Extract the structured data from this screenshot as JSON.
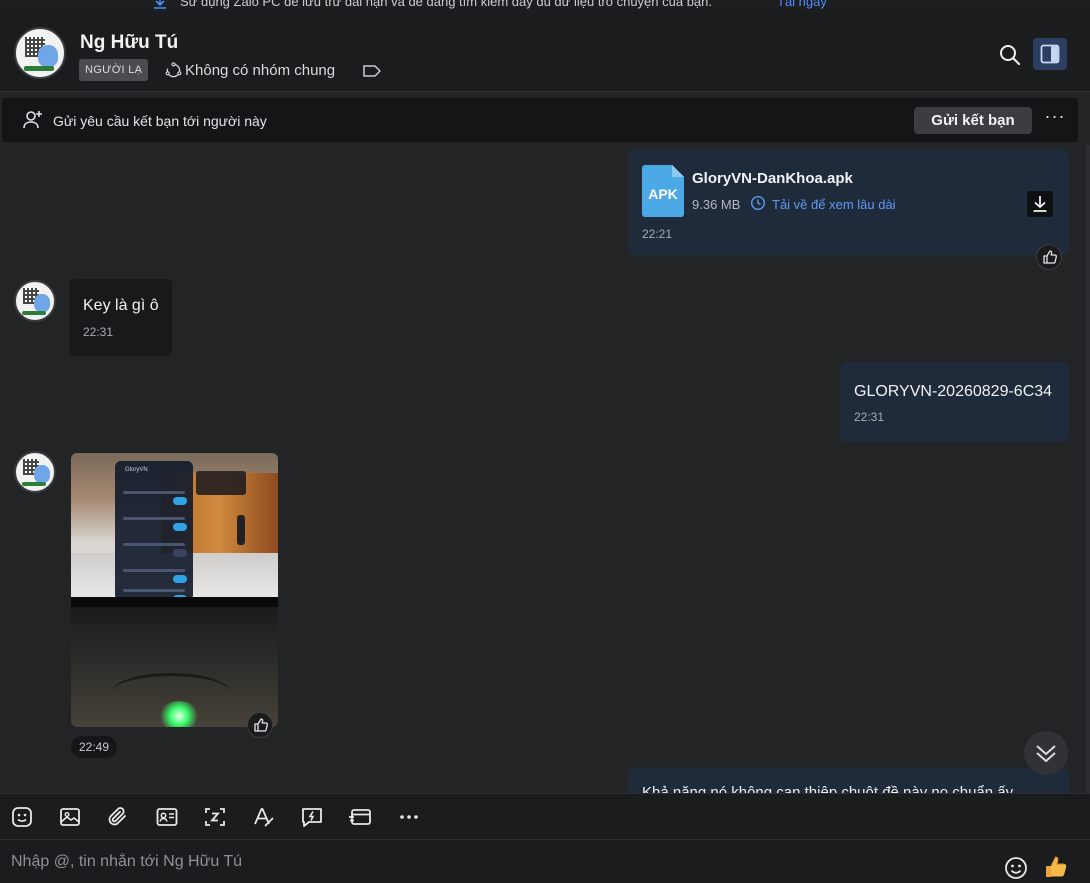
{
  "banner": {
    "text": "Sử dụng Zalo PC để lưu trữ dài hạn và dễ dàng tìm kiếm đầy đủ dữ liệu trò chuyện của bạn.",
    "link": "Tải ngay"
  },
  "header": {
    "name": "Ng Hữu Tú",
    "badge": "NGƯỜI LẠ",
    "groups": "Không có nhóm chung"
  },
  "friend_bar": {
    "text": "Gửi yêu cầu kết bạn tới người này",
    "button": "Gửi kết bạn",
    "more": "···"
  },
  "messages": {
    "file": {
      "icon_label": "APK",
      "name": "GloryVN-DanKhoa.apk",
      "size": "9.36 MB",
      "keep": "Tải về để xem lâu dài",
      "time": "22:21"
    },
    "in_text": {
      "text": "Key là gì ô",
      "time": "22:31"
    },
    "out_key": {
      "text": "GLORYVN-20260829-6C34",
      "time": "22:31"
    },
    "image": {
      "menu_title": "GloryVN",
      "time": "22:49"
    },
    "partial": {
      "text": "Khả năng nó không can thiệp chuột đề này no chuẩn ấy"
    }
  },
  "composer": {
    "placeholder": "Nhập @, tin nhắn tới Ng Hữu Tú"
  },
  "colors": {
    "accent": "#5f9bf0",
    "outgoing_bubble": "#1f2a3a",
    "incoming_bubble": "#18191b",
    "background": "#232425"
  }
}
